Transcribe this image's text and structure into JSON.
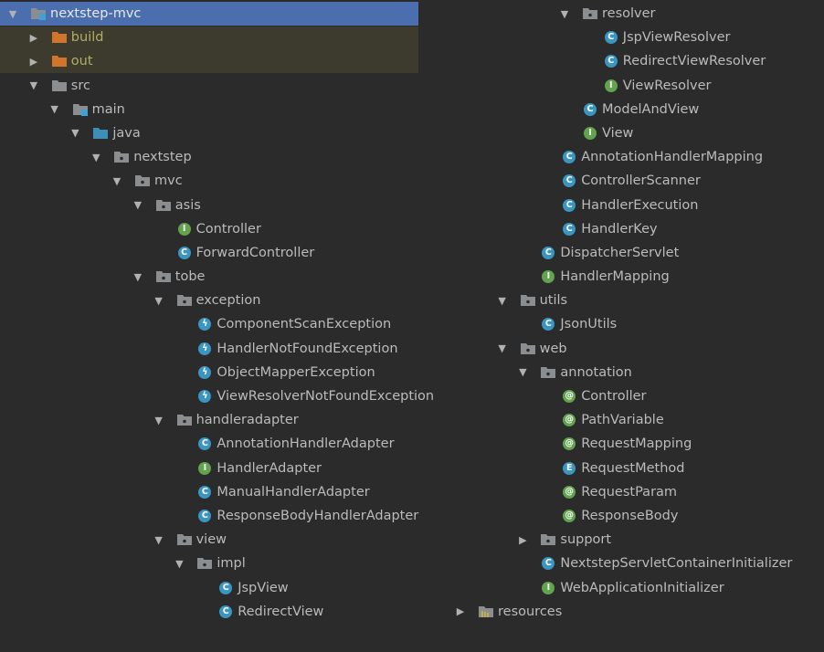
{
  "colors": {
    "background": "#2b2b2b",
    "selection": "#4b6eaf",
    "excluded_row": "#3c3b2e",
    "excluded_text": "#b3ae60",
    "class_badge": "#3a96c0",
    "interface_badge": "#62a34e",
    "excluded_folder": "#d2742c",
    "source_folder": "#3d8fb8",
    "package_folder": "#8b8e91"
  },
  "left_column": [
    {
      "label": "nextstep-mvc",
      "depth": 0,
      "arrow": "down",
      "icon": "module",
      "selected": true
    },
    {
      "label": "build",
      "depth": 1,
      "arrow": "right",
      "icon": "excluded-folder",
      "excluded": true
    },
    {
      "label": "out",
      "depth": 1,
      "arrow": "right",
      "icon": "excluded-folder",
      "excluded": true
    },
    {
      "label": "src",
      "depth": 1,
      "arrow": "down",
      "icon": "folder"
    },
    {
      "label": "main",
      "depth": 2,
      "arrow": "down",
      "icon": "module-folder"
    },
    {
      "label": "java",
      "depth": 3,
      "arrow": "down",
      "icon": "source-folder"
    },
    {
      "label": "nextstep",
      "depth": 4,
      "arrow": "down",
      "icon": "package"
    },
    {
      "label": "mvc",
      "depth": 5,
      "arrow": "down",
      "icon": "package"
    },
    {
      "label": "asis",
      "depth": 6,
      "arrow": "down",
      "icon": "package"
    },
    {
      "label": "Controller",
      "depth": 7,
      "icon": "interface"
    },
    {
      "label": "ForwardController",
      "depth": 7,
      "icon": "class"
    },
    {
      "label": "tobe",
      "depth": 6,
      "arrow": "down",
      "icon": "package"
    },
    {
      "label": "exception",
      "depth": 7,
      "arrow": "down",
      "icon": "package"
    },
    {
      "label": "ComponentScanException",
      "depth": 8,
      "icon": "exception"
    },
    {
      "label": "HandlerNotFoundException",
      "depth": 8,
      "icon": "exception"
    },
    {
      "label": "ObjectMapperException",
      "depth": 8,
      "icon": "exception"
    },
    {
      "label": "ViewResolverNotFoundException",
      "depth": 8,
      "icon": "exception"
    },
    {
      "label": "handleradapter",
      "depth": 7,
      "arrow": "down",
      "icon": "package"
    },
    {
      "label": "AnnotationHandlerAdapter",
      "depth": 8,
      "icon": "class"
    },
    {
      "label": "HandlerAdapter",
      "depth": 8,
      "icon": "interface"
    },
    {
      "label": "ManualHandlerAdapter",
      "depth": 8,
      "icon": "class"
    },
    {
      "label": "ResponseBodyHandlerAdapter",
      "depth": 8,
      "icon": "class"
    },
    {
      "label": "view",
      "depth": 7,
      "arrow": "down",
      "icon": "package"
    },
    {
      "label": "impl",
      "depth": 8,
      "arrow": "down",
      "icon": "package"
    },
    {
      "label": "JspView",
      "depth": 9,
      "icon": "class"
    },
    {
      "label": "RedirectView",
      "depth": 9,
      "icon": "class"
    }
  ],
  "right_column": [
    {
      "label": "resolver",
      "depth": 5,
      "arrow": "down",
      "icon": "package"
    },
    {
      "label": "JspViewResolver",
      "depth": 6,
      "icon": "class"
    },
    {
      "label": "RedirectViewResolver",
      "depth": 6,
      "icon": "class"
    },
    {
      "label": "ViewResolver",
      "depth": 6,
      "icon": "interface"
    },
    {
      "label": "ModelAndView",
      "depth": 5,
      "icon": "class"
    },
    {
      "label": "View",
      "depth": 5,
      "icon": "interface"
    },
    {
      "label": "AnnotationHandlerMapping",
      "depth": 4,
      "icon": "class"
    },
    {
      "label": "ControllerScanner",
      "depth": 4,
      "icon": "class"
    },
    {
      "label": "HandlerExecution",
      "depth": 4,
      "icon": "class"
    },
    {
      "label": "HandlerKey",
      "depth": 4,
      "icon": "class"
    },
    {
      "label": "DispatcherServlet",
      "depth": 3,
      "icon": "class"
    },
    {
      "label": "HandlerMapping",
      "depth": 3,
      "icon": "interface"
    },
    {
      "label": "utils",
      "depth": 2,
      "arrow": "down",
      "icon": "package"
    },
    {
      "label": "JsonUtils",
      "depth": 3,
      "icon": "class"
    },
    {
      "label": "web",
      "depth": 2,
      "arrow": "down",
      "icon": "package"
    },
    {
      "label": "annotation",
      "depth": 3,
      "arrow": "down",
      "icon": "package"
    },
    {
      "label": "Controller",
      "depth": 4,
      "icon": "annotation"
    },
    {
      "label": "PathVariable",
      "depth": 4,
      "icon": "annotation"
    },
    {
      "label": "RequestMapping",
      "depth": 4,
      "icon": "annotation"
    },
    {
      "label": "RequestMethod",
      "depth": 4,
      "icon": "enum"
    },
    {
      "label": "RequestParam",
      "depth": 4,
      "icon": "annotation"
    },
    {
      "label": "ResponseBody",
      "depth": 4,
      "icon": "annotation"
    },
    {
      "label": "support",
      "depth": 3,
      "arrow": "right",
      "icon": "package"
    },
    {
      "label": "NextstepServletContainerInitializer",
      "depth": 3,
      "icon": "class"
    },
    {
      "label": "WebApplicationInitializer",
      "depth": 3,
      "icon": "interface"
    },
    {
      "label": "resources",
      "depth": 0,
      "arrow": "right",
      "icon": "resources-folder"
    }
  ]
}
